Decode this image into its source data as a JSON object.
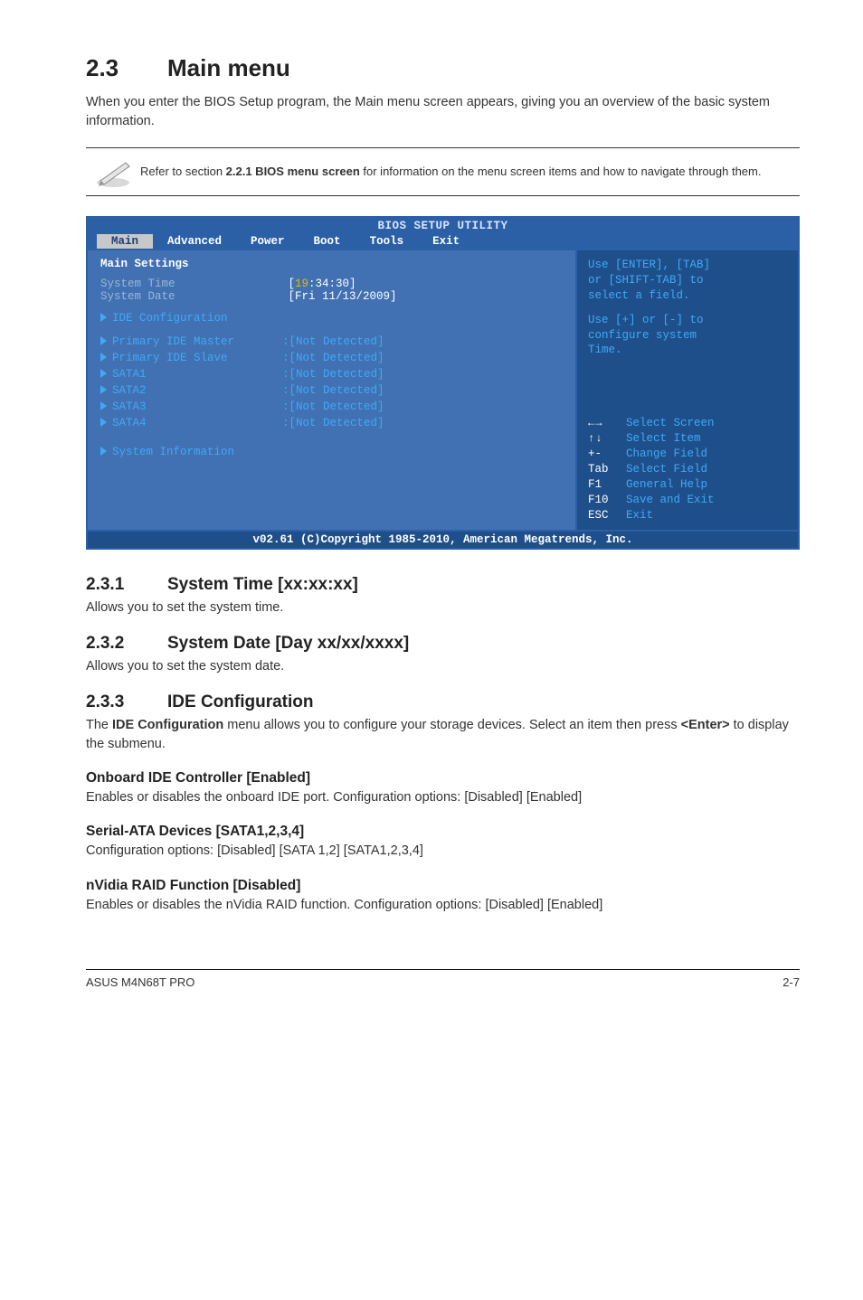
{
  "section": {
    "number": "2.3",
    "title": "Main menu",
    "intro": "When you enter the BIOS Setup program, the Main menu screen appears, giving you an overview of the basic system information."
  },
  "note": {
    "prefix": "Refer to section ",
    "bold": "2.2.1 BIOS menu screen",
    "suffix": " for information on the menu screen items and how to navigate through them."
  },
  "bios": {
    "title": "BIOS SETUP UTILITY",
    "tabs": [
      "Main",
      "Advanced",
      "Power",
      "Boot",
      "Tools",
      "Exit"
    ],
    "active_tab": "Main",
    "heading": "Main Settings",
    "system_time_label": "System Time",
    "system_time_value_pre": "[",
    "system_time_hour": "19",
    "system_time_rest": ":34:30]",
    "system_date_label": "System Date",
    "system_date_value": "[Fri 11/13/2009]",
    "ide_conf_label": "IDE Configuration",
    "ide_items": [
      {
        "label": "Primary IDE Master",
        "value": ":[Not Detected]"
      },
      {
        "label": "Primary IDE Slave",
        "value": ":[Not Detected]"
      },
      {
        "label": "SATA1",
        "value": ":[Not Detected]"
      },
      {
        "label": "SATA2",
        "value": ":[Not Detected]"
      },
      {
        "label": "SATA3",
        "value": ":[Not Detected]"
      },
      {
        "label": "SATA4",
        "value": ":[Not Detected]"
      }
    ],
    "sysinfo_label": "System Information",
    "help_top_1": "Use [ENTER], [TAB]",
    "help_top_2": "or [SHIFT-TAB] to",
    "help_top_3": "select a field.",
    "help_mid_1": "Use [+] or [-] to",
    "help_mid_2": "configure system",
    "help_mid_3": "Time.",
    "nav": {
      "k0": "←→",
      "d0": "Select Screen",
      "k1": "↑↓",
      "d1": "Select Item",
      "k2": "+-",
      "d2": "Change Field",
      "k3": "Tab",
      "d3": "Select Field",
      "k4": "F1",
      "d4": "General Help",
      "k5": "F10",
      "d5": "Save and Exit",
      "k6": "ESC",
      "d6": "Exit"
    },
    "copyright": "v02.61 (C)Copyright 1985-2010, American Megatrends, Inc."
  },
  "sub": {
    "s1": {
      "num": "2.3.1",
      "title": "System Time [xx:xx:xx]",
      "text": "Allows you to set the system time."
    },
    "s2": {
      "num": "2.3.2",
      "title": "System Date [Day xx/xx/xxxx]",
      "text": "Allows you to set the system date."
    },
    "s3": {
      "num": "2.3.3",
      "title": "IDE Configuration",
      "p_pre": "The ",
      "p_bold": "IDE Configuration",
      "p_mid": " menu allows you to configure your storage devices. Select an item then press ",
      "p_bold2": "<Enter>",
      "p_suf": " to display the submenu.",
      "h1": "Onboard IDE Controller [Enabled]",
      "t1": "Enables or disables the onboard IDE port. Configuration options: [Disabled] [Enabled]",
      "h2": "Serial-ATA Devices [SATA1,2,3,4]",
      "t2": "Configuration options: [Disabled] [SATA 1,2] [SATA1,2,3,4]",
      "h3": "nVidia RAID Function [Disabled]",
      "t3": "Enables or disables the nVidia RAID function. Configuration options: [Disabled] [Enabled]"
    }
  },
  "footer": {
    "left": "ASUS M4N68T PRO",
    "right": "2-7"
  }
}
